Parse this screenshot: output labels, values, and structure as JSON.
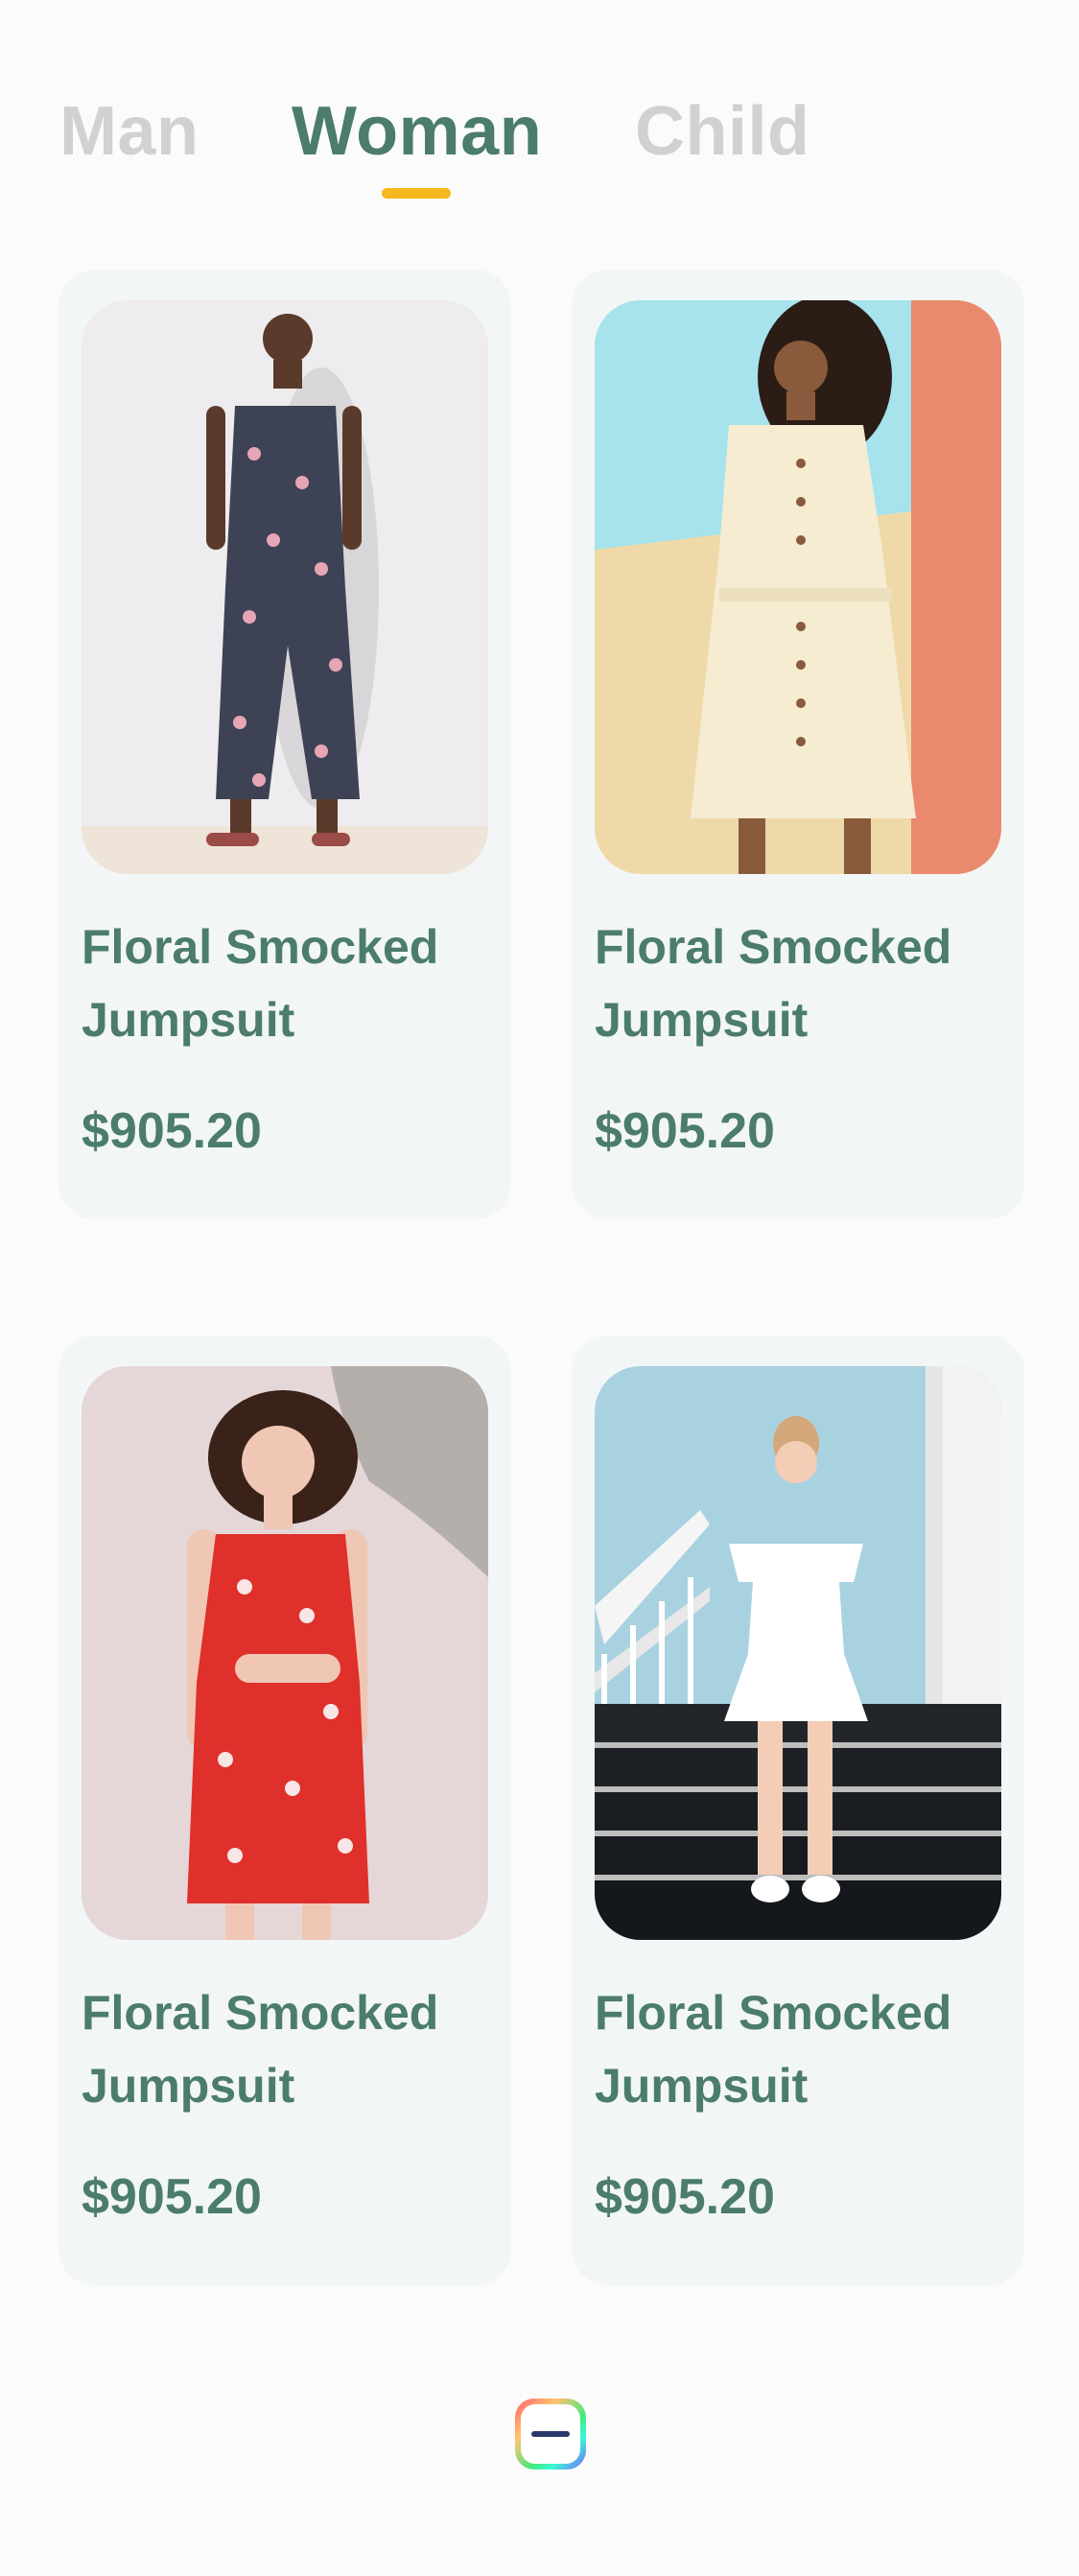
{
  "tabs": [
    {
      "label": "Man",
      "active": false
    },
    {
      "label": "Woman",
      "active": true
    },
    {
      "label": "Child",
      "active": false
    }
  ],
  "colors": {
    "accent": "#4b7c6e",
    "tab_inactive": "#cfd2d1",
    "indicator": "#f5b81f",
    "card_background": "#f2f6f6"
  },
  "products": [
    {
      "name": "Floral Smocked Jumpsuit",
      "price": "$905.20",
      "image": "woman-floral-jumpsuit-photo"
    },
    {
      "name": "Floral Smocked Jumpsuit",
      "price": "$905.20",
      "image": "woman-cream-button-dress-photo"
    },
    {
      "name": "Floral Smocked Jumpsuit",
      "price": "$905.20",
      "image": "woman-red-floral-dress-photo"
    },
    {
      "name": "Floral Smocked Jumpsuit",
      "price": "$905.20",
      "image": "woman-white-offshoulder-dress-photo"
    }
  ],
  "bottom_icon": "app-logo-icon"
}
